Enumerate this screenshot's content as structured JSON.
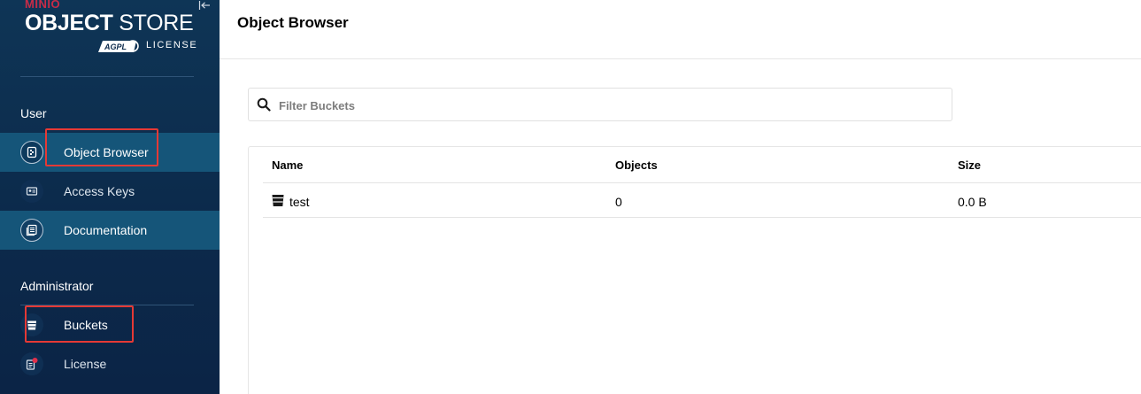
{
  "brand": {
    "minio": "MINIO",
    "product_bold": "OBJECT",
    "product_light": "STORE",
    "agpl": "AGPLv3",
    "license": "LICENSE"
  },
  "sidebar": {
    "sections": [
      {
        "title": "User",
        "items": [
          {
            "label": "Object Browser",
            "icon": "object-browser-icon",
            "active": true
          },
          {
            "label": "Access Keys",
            "icon": "access-keys-icon",
            "active": false
          },
          {
            "label": "Documentation",
            "icon": "documentation-icon",
            "active": false
          }
        ]
      },
      {
        "title": "Administrator",
        "items": [
          {
            "label": "Buckets",
            "icon": "bucket-icon",
            "active": false
          },
          {
            "label": "License",
            "icon": "license-icon",
            "active": false
          }
        ]
      }
    ]
  },
  "main": {
    "title": "Object Browser",
    "filter": {
      "placeholder": "Filter Buckets",
      "value": ""
    },
    "table": {
      "columns": [
        "Name",
        "Objects",
        "Size"
      ],
      "rows": [
        {
          "name": "test",
          "objects": "0",
          "size": "0.0 B"
        }
      ]
    }
  },
  "colors": {
    "sidebar_bg": "#0c2a4b",
    "active_item_bg": "#155579",
    "brand_red": "#c72c48",
    "highlight_box": "#e53935"
  }
}
